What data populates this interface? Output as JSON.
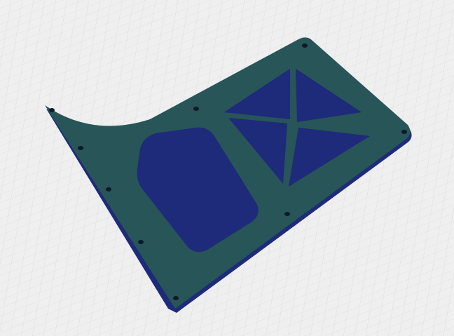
{
  "scene": {
    "background_color": "#efefef",
    "grid_color": "#dcdcdc",
    "plate_color": "#275558",
    "plate_edge_color": "#1e2a7a"
  }
}
